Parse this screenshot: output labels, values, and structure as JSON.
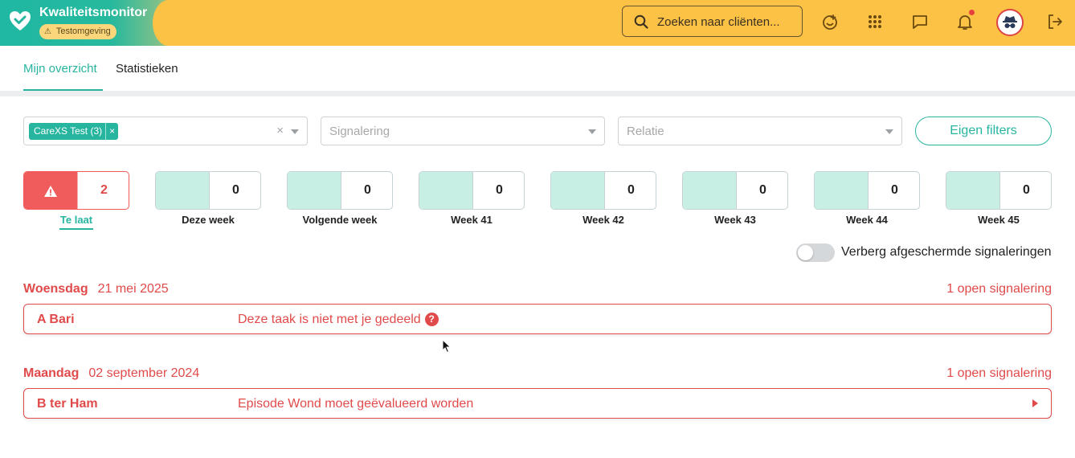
{
  "header": {
    "app_title": "Kwaliteitsmonitor",
    "env_badge": "Testomgeving",
    "search_placeholder": "Zoeken naar cliënten...",
    "brand_color": "#27b5a0",
    "bar_color": "#fcc246",
    "icons": [
      "heart-logo-icon",
      "warning-icon",
      "search-icon",
      "happy-plus-icon",
      "apps-grid-icon",
      "chat-icon",
      "bell-icon",
      "spy-avatar-icon",
      "logout-icon"
    ]
  },
  "tabs": [
    {
      "label": "Mijn overzicht",
      "active": true
    },
    {
      "label": "Statistieken",
      "active": false
    }
  ],
  "filters": {
    "chip_label": "CareXS Test (3)",
    "chip_remove": "×",
    "clear": "×",
    "signalering_placeholder": "Signalering",
    "relatie_placeholder": "Relatie",
    "eigen_filters_label": "Eigen filters"
  },
  "weeks": [
    {
      "label": "Te laat",
      "count": "2",
      "overdue": true
    },
    {
      "label": "Deze week",
      "count": "0"
    },
    {
      "label": "Volgende week",
      "count": "0"
    },
    {
      "label": "Week 41",
      "count": "0"
    },
    {
      "label": "Week 42",
      "count": "0"
    },
    {
      "label": "Week 43",
      "count": "0"
    },
    {
      "label": "Week 44",
      "count": "0"
    },
    {
      "label": "Week 45",
      "count": "0"
    }
  ],
  "toggle": {
    "label": "Verberg afgeschermde signaleringen",
    "on": false
  },
  "groups": [
    {
      "day": "Woensdag",
      "date": "21 mei 2025",
      "count": "1 open signalering",
      "items": [
        {
          "name": "A Bari",
          "description": "Deze taak is niet met je gedeeld",
          "help": "?"
        }
      ]
    },
    {
      "day": "Maandag",
      "date": "02 september 2024",
      "count": "1 open signalering",
      "items": [
        {
          "name": "B ter Ham",
          "description": "Episode Wond moet geëvalueerd worden"
        }
      ]
    }
  ],
  "colors": {
    "alert": "#e14a4a",
    "teal": "#27b5a0",
    "mint": "#c8efe4"
  }
}
